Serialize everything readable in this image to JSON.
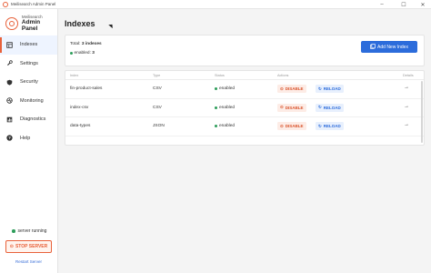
{
  "window": {
    "title": "Meilisearch Admin Panel",
    "minimize": "–",
    "maximize": "☐",
    "close": "✕"
  },
  "brand": {
    "name": "Meilisearch",
    "title": "Admin Panel"
  },
  "sidebar": {
    "items": [
      {
        "label": "Indexes",
        "icon": "database-icon",
        "active": true
      },
      {
        "label": "Settings",
        "icon": "wrench-icon",
        "active": false
      },
      {
        "label": "Security",
        "icon": "shield-icon",
        "active": false
      },
      {
        "label": "Monitoring",
        "icon": "activity-icon",
        "active": false
      },
      {
        "label": "Diagnostics",
        "icon": "chart-icon",
        "active": false
      },
      {
        "label": "Help",
        "icon": "help-icon",
        "active": false
      }
    ],
    "status": "server running",
    "stop_label": "STOP SERVER",
    "restart_label": "Restart Server"
  },
  "page": {
    "title": "Indexes"
  },
  "summary": {
    "total_label": "Total:",
    "total_value": "3 indexes",
    "enabled_label": "enabled:",
    "enabled_value": "3"
  },
  "add_button": "Add New Index",
  "table": {
    "columns": [
      "Index",
      "Type",
      "Status",
      "Actions",
      "Details"
    ],
    "rows": [
      {
        "index": "fin-product-sales",
        "type": "CSV",
        "status": "enabled",
        "disable": "DISABLE",
        "reload": "RELOAD"
      },
      {
        "index": "index-csv",
        "type": "CSV",
        "status": "enabled",
        "disable": "DISABLE",
        "reload": "RELOAD"
      },
      {
        "index": "data-types",
        "type": "JSON",
        "status": "enabled",
        "disable": "DISABLE",
        "reload": "RELOAD"
      }
    ]
  },
  "colors": {
    "accent": "#e8613a",
    "primary": "#2c6cdb",
    "success": "#2e9e5b"
  }
}
